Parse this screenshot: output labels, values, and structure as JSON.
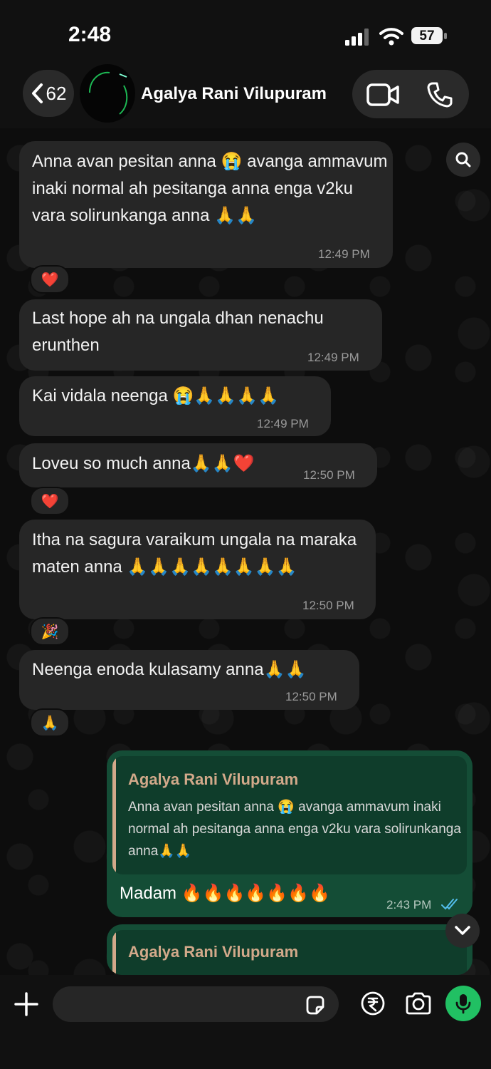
{
  "status_bar": {
    "time": "2:48",
    "battery": "57"
  },
  "header": {
    "back_count": "62",
    "contact_name": "Agalya Rani Vilupuram"
  },
  "messages": [
    {
      "text": "Anna avan pesitan anna 😭 avanga ammavum inaki normal ah pesitanga anna enga v2ku vara solirunkanga anna 🙏🙏",
      "time": "12:49 PM",
      "reaction": "❤️"
    },
    {
      "text": "Last hope ah na ungala dhan nenachu erunthen",
      "time": "12:49 PM"
    },
    {
      "text": "Kai vidala neenga 😭🙏🙏🙏🙏",
      "time": "12:49 PM"
    },
    {
      "text": "Loveu so much anna🙏🙏❤️",
      "time": "12:50 PM",
      "reaction": "❤️"
    },
    {
      "text": "Itha na sagura varaikum ungala na maraka maten anna 🙏🙏🙏🙏🙏🙏🙏🙏",
      "time": "12:50 PM",
      "reaction": "🎉"
    },
    {
      "text": "Neenga enoda kulasamy anna🙏🙏",
      "time": "12:50 PM",
      "reaction": "🙏"
    }
  ],
  "outgoing": [
    {
      "quote_name": "Agalya Rani Vilupuram",
      "quote_text": "Anna avan pesitan anna 😭 avanga ammavum inaki normal ah pesitanga anna enga v2ku vara solirunkanga anna🙏🙏",
      "text": "Madam 🔥🔥🔥🔥🔥🔥🔥",
      "time": "2:43 PM"
    },
    {
      "quote_name": "Agalya Rani Vilupuram"
    }
  ],
  "colors": {
    "outgoing_bubble": "#144d36",
    "quote_name": "#d2a98a",
    "mic": "#21c063",
    "read_ticks": "#53bdeb"
  },
  "icons": [
    "back-chevron-icon",
    "video-call-icon",
    "phone-icon",
    "search-icon",
    "chevron-down-icon",
    "plus-icon",
    "sticker-icon",
    "rupee-icon",
    "camera-icon",
    "mic-icon"
  ]
}
